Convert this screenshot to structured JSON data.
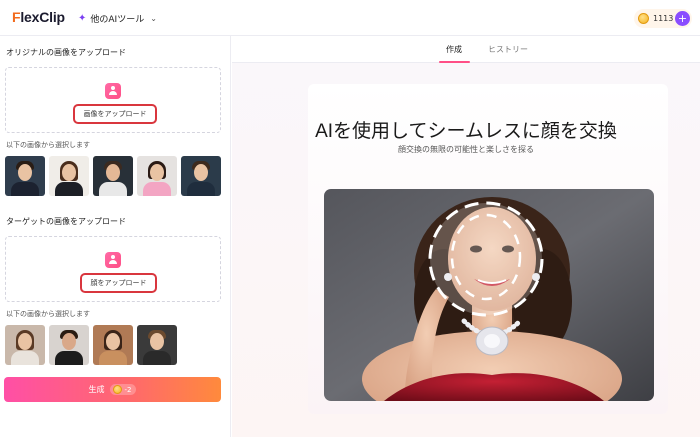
{
  "header": {
    "logo_prefix": "F",
    "logo_rest": "lexClip",
    "tools_menu_label": "他のAIツール",
    "credits": "1113",
    "plus_symbol": "+"
  },
  "left": {
    "source_section_title": "オリジナルの画像をアップロード",
    "source_upload_label": "画像をアップロード",
    "source_hint": "以下の画像から選択します",
    "target_section_title": "ターゲットの画像をアップロード",
    "target_upload_label": "顔をアップロード",
    "target_hint": "以下の画像から選択します",
    "generate_label": "生成",
    "generate_cost": "-2"
  },
  "right": {
    "tabs": [
      {
        "label": "作成"
      },
      {
        "label": "ヒストリー"
      }
    ],
    "hero_title": "AIを使用してシームレスに顔を交換",
    "hero_subtitle": "顔交換の無限の可能性と楽しさを探る"
  },
  "colors": {
    "accent_pink": "#ff4f86",
    "accent_purple": "#8a4dff",
    "highlight_red": "#d9363e",
    "logo_orange": "#f26b1d"
  },
  "icons": [
    "sparkle-icon",
    "chevron-down-icon",
    "coin-icon",
    "plus-icon",
    "upload-person-icon",
    "upload-face-icon"
  ]
}
